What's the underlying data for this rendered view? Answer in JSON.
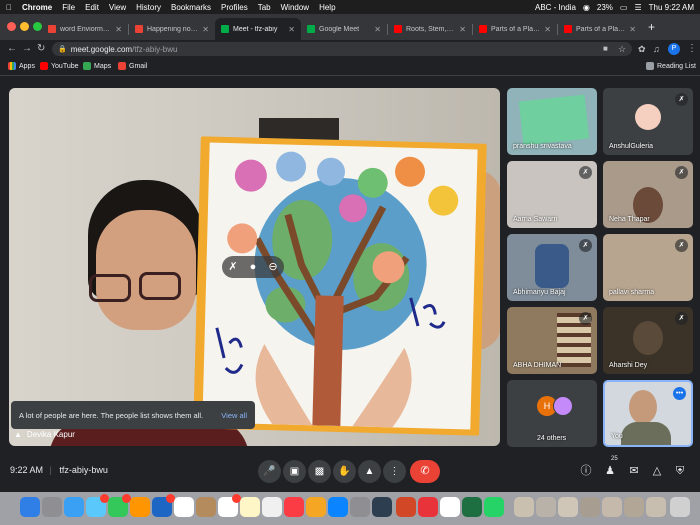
{
  "menubar": {
    "app": "Chrome",
    "items": [
      "File",
      "Edit",
      "View",
      "History",
      "Bookmarks",
      "Profiles",
      "Tab",
      "Window",
      "Help"
    ],
    "keyboard": "ABC - India",
    "battery": "23%",
    "clock": "Thu 9:22 AM"
  },
  "tabs": [
    {
      "title": "word Enviorment d"
    },
    {
      "title": "Happening now: Pa"
    },
    {
      "title": "Meet - tfz-abiy"
    },
    {
      "title": "Google Meet"
    },
    {
      "title": "Roots, Stem, Leave"
    },
    {
      "title": "Parts of a Plant for"
    },
    {
      "title": "Parts of a Plant for"
    }
  ],
  "address": {
    "host": "meet.google.com",
    "path": "/tfz-abiy-bwu"
  },
  "profile_initial": "P",
  "bookmarks": {
    "items": [
      "Apps",
      "YouTube",
      "Maps",
      "Gmail"
    ],
    "reading_list": "Reading List"
  },
  "stage": {
    "speaker_name": "Devika Kapur"
  },
  "toast": {
    "message": "A lot of people are here. The people list shows them all.",
    "action": "View all"
  },
  "tiles": [
    {
      "name": "pranshu srivastava"
    },
    {
      "name": "AnshulGuleria"
    },
    {
      "name": "Aarna Sawarn"
    },
    {
      "name": "Neha Thapar"
    },
    {
      "name": "Abhimanyu Bajaj"
    },
    {
      "name": "pallavi sharma"
    },
    {
      "name": "ABHA DHIMAN"
    },
    {
      "name": "Aharshi Dey"
    },
    {
      "name": "24 others",
      "avatar_letter": "H"
    },
    {
      "name": "You"
    }
  ],
  "bottombar": {
    "time": "9:22 AM",
    "meeting_code": "tfz-abiy-bwu",
    "participants_count": "25"
  },
  "colors": {
    "end_call": "#ea4335",
    "accent_blue": "#8ab4f8",
    "dark_bg": "#202124"
  }
}
